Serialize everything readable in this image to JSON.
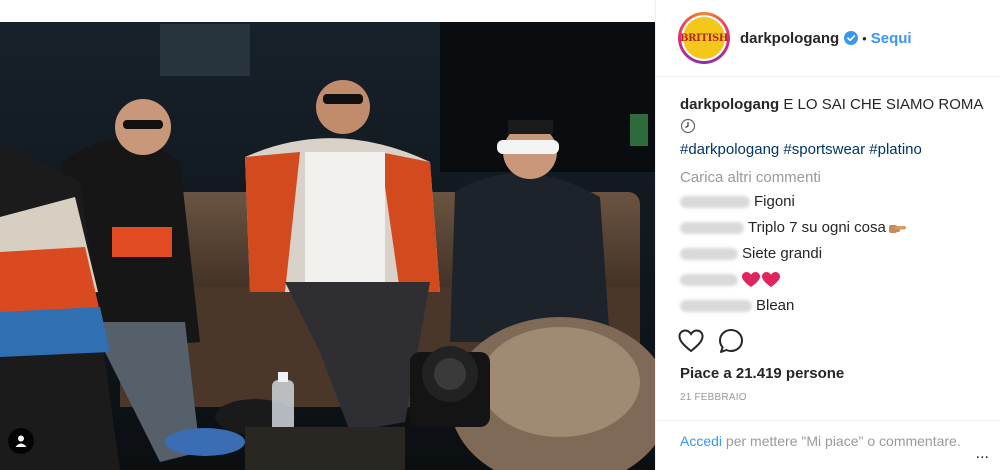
{
  "post": {
    "username": "darkpologang",
    "follow_label": "Sequi",
    "separator": "•",
    "avatar_text": "BRITISH",
    "caption_text": "E LO SAI CHE SIAMO ROMA",
    "hashtags": "#darkpologang #sportswear #platino",
    "load_more": "Carica altri commenti",
    "comments": [
      {
        "text": "Figoni",
        "name_width": 70
      },
      {
        "text": "Triplo 7 su ogni cosa",
        "name_width": 64
      },
      {
        "text": "Siete grandi",
        "name_width": 58
      },
      {
        "text": "",
        "name_width": 58
      },
      {
        "text": "Blean",
        "name_width": 72
      }
    ],
    "likes": "Piace a 21.419 persone",
    "date": "21 FEBBRAIO",
    "footer_login": "Accedi",
    "footer_rest": " per mettere \"Mi piace\" o commentare.",
    "more": "..."
  },
  "icons": {
    "verified": "verified-badge-icon",
    "like": "heart-outline-icon",
    "comment": "speech-bubble-icon",
    "user_tag": "person-tag-icon",
    "clock_emoji": "clock-emoji-icon",
    "hand_emoji": "pointing-hand-emoji-icon",
    "heart_emoji": "red-heart-emoji-icon"
  },
  "colors": {
    "link": "#3897f0",
    "hashtag": "#003569",
    "muted": "#999999",
    "verified": "#3897f0"
  }
}
